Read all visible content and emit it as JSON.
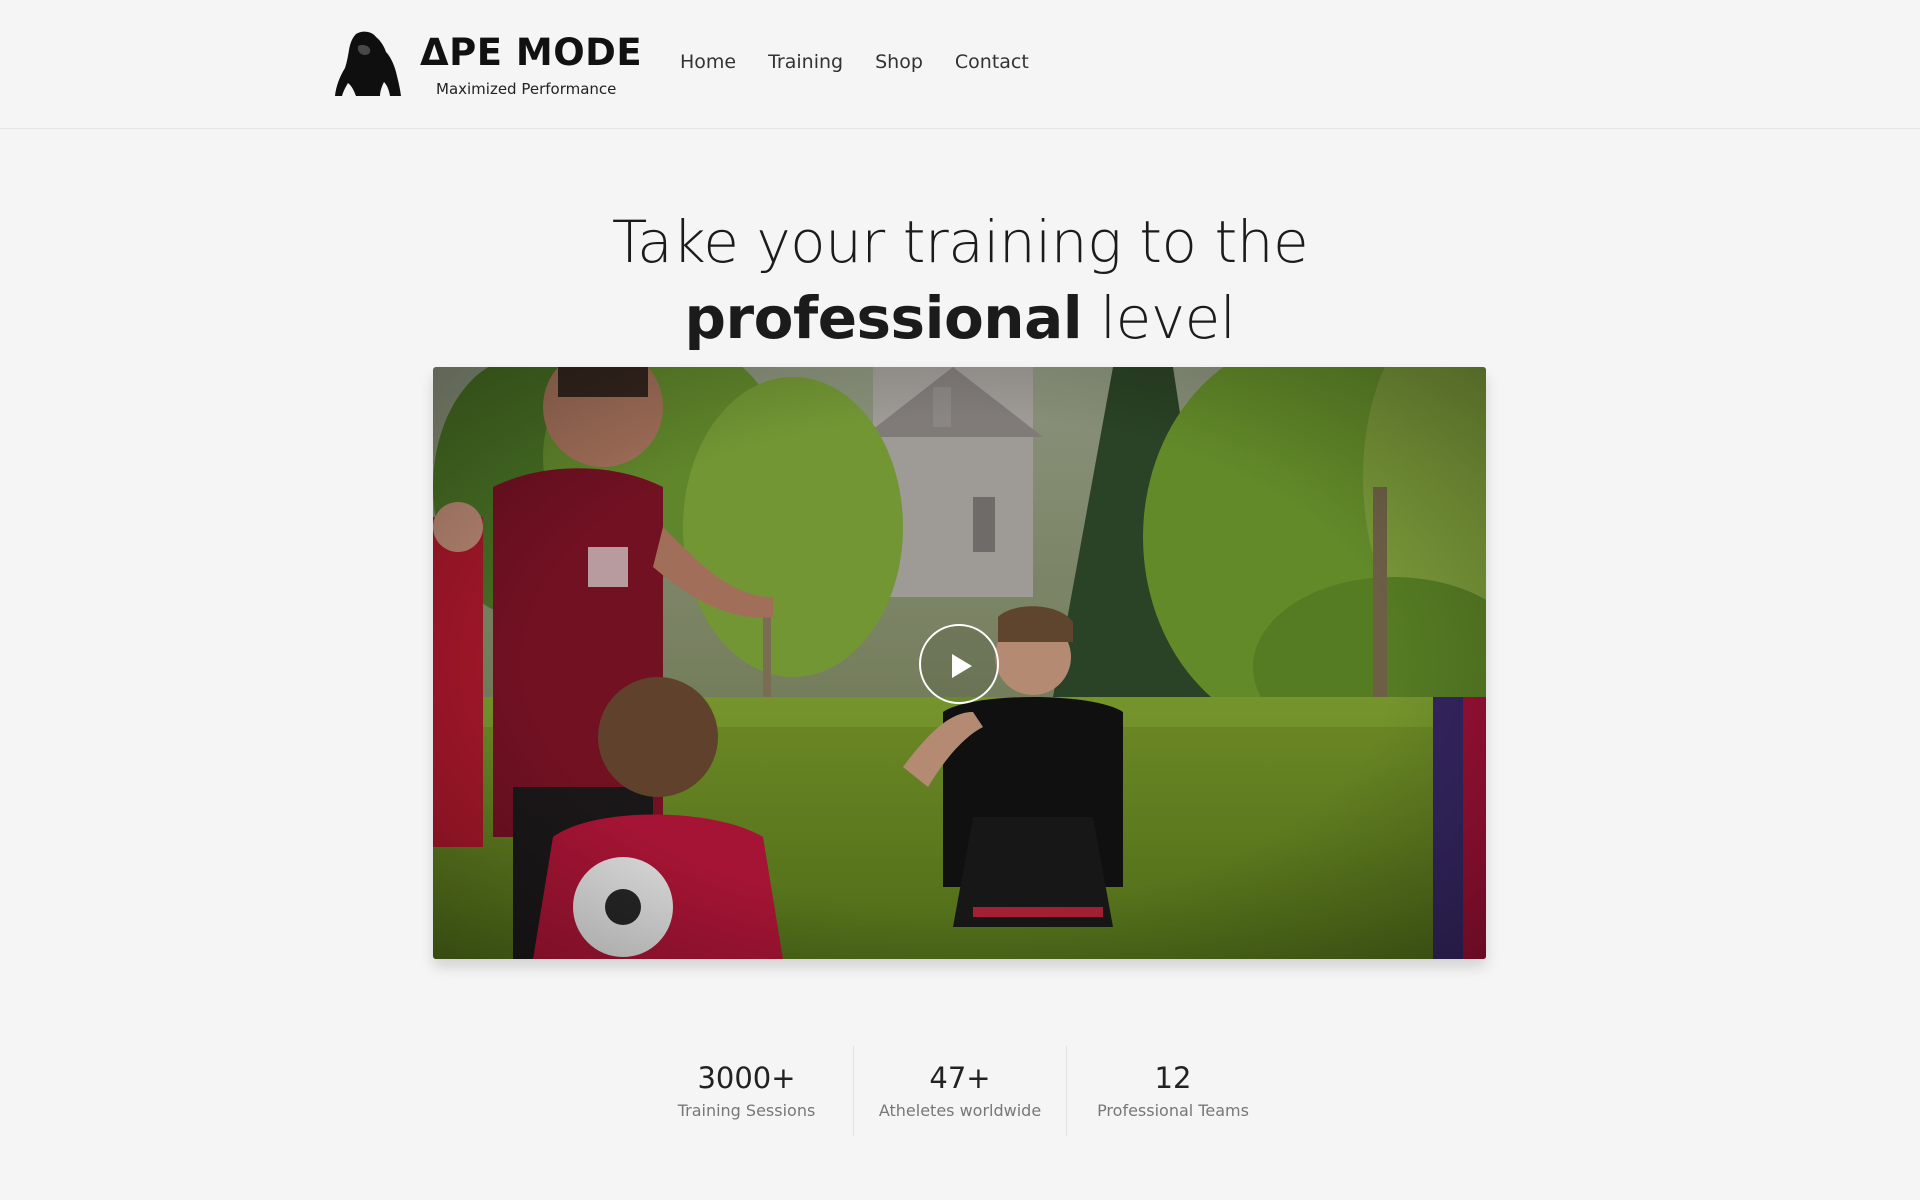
{
  "brand": {
    "name": "ΔPE MODE",
    "tagline": "Maximized Performance",
    "logo_icon": "gorilla-icon"
  },
  "nav": {
    "items": [
      {
        "label": "Home"
      },
      {
        "label": "Training"
      },
      {
        "label": "Shop"
      },
      {
        "label": "Contact"
      }
    ]
  },
  "hero": {
    "title_line1": "Take your training to the",
    "title_strong": "professional",
    "title_rest": " level"
  },
  "video": {
    "play_icon": "play-icon"
  },
  "stats": [
    {
      "value": "3000+",
      "label": "Training Sessions"
    },
    {
      "value": "47+",
      "label": "Atheletes worldwide"
    },
    {
      "value": "12",
      "label": "Professional Teams"
    }
  ],
  "colors": {
    "background": "#f5f5f5",
    "text": "#1b1b1b",
    "muted": "#777777"
  }
}
